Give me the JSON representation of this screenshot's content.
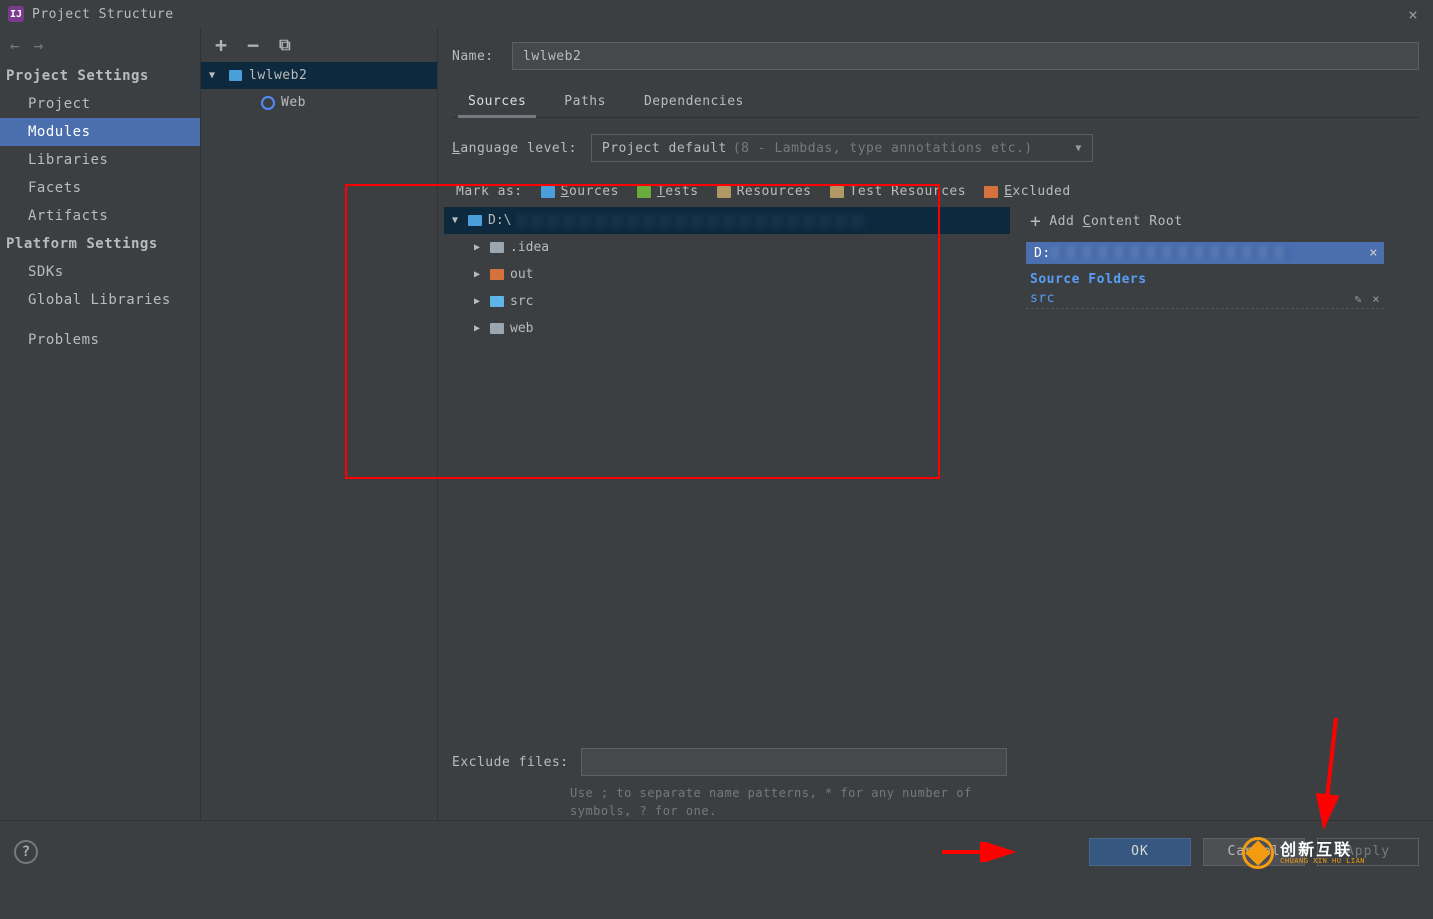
{
  "window": {
    "title": "Project Structure"
  },
  "sidebar": {
    "sections": [
      {
        "header": "Project Settings",
        "items": [
          "Project",
          "Modules",
          "Libraries",
          "Facets",
          "Artifacts"
        ],
        "active_index": 1
      },
      {
        "header": "Platform Settings",
        "items": [
          "SDKs",
          "Global Libraries"
        ]
      }
    ],
    "problems": "Problems"
  },
  "module_tree": {
    "root": "lwlweb2",
    "children": [
      {
        "label": "Web",
        "icon": "web-facet"
      }
    ]
  },
  "module": {
    "name_label": "Name:",
    "name_value": "lwlweb2",
    "tabs": [
      "Sources",
      "Paths",
      "Dependencies"
    ],
    "active_tab": 0,
    "language_level_label": "Language level:",
    "language_level_value": "Project default",
    "language_level_hint": "(8 - Lambdas, type annotations etc.)",
    "mark_as_label": "Mark as:",
    "mark_buttons": [
      {
        "label": "Sources",
        "color": "#4a9ed9"
      },
      {
        "label": "Tests",
        "color": "#6aab3e"
      },
      {
        "label": "Resources",
        "color": "#b09763"
      },
      {
        "label": "Test Resources",
        "color": "#b09763"
      },
      {
        "label": "Excluded",
        "color": "#d6733c"
      }
    ],
    "folder_tree": {
      "root_prefix": "D:\\",
      "children": [
        {
          "label": ".idea",
          "color": "gray"
        },
        {
          "label": "out",
          "color": "orange"
        },
        {
          "label": "src",
          "color": "lightblue"
        },
        {
          "label": "web",
          "color": "gray"
        }
      ]
    },
    "add_content_root": "Add Content Root",
    "content_root_prefix": "D:",
    "source_folders_header": "Source Folders",
    "source_folders": [
      "src"
    ],
    "exclude_label": "Exclude files:",
    "exclude_value": "",
    "exclude_hint": "Use ; to separate name patterns, * for any number of symbols, ? for one."
  },
  "footer": {
    "ok": "OK",
    "cancel": "Cancel",
    "apply": "Apply"
  },
  "logo": {
    "cn": "创新互联",
    "en": "CHUANG XIN HU LIAN"
  }
}
